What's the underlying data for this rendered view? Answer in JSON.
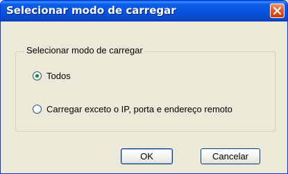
{
  "window": {
    "title": "Selecionar modo de carregar"
  },
  "group": {
    "legend": "Selecionar modo de carregar",
    "options": [
      {
        "label": "Todos",
        "selected": true
      },
      {
        "label": "Carregar exceto o IP, porta e endereço remoto",
        "selected": false
      }
    ]
  },
  "buttons": {
    "ok": "OK",
    "cancel": "Cancelar"
  }
}
